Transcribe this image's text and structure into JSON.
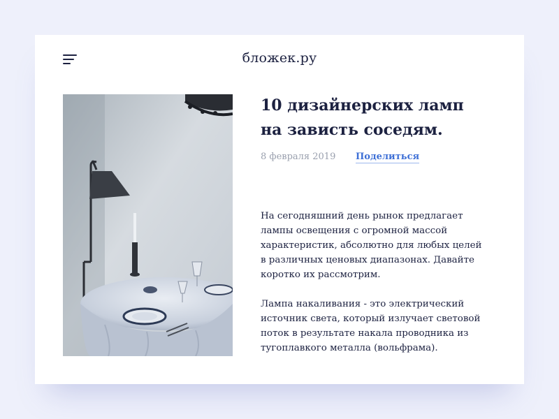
{
  "header": {
    "brand": "бложек.ру",
    "menu_icon": "hamburger-menu-icon"
  },
  "article": {
    "title_lines": [
      "10 дизайнерских ламп",
      "на зависть соседям."
    ],
    "date": "8 февраля 2019",
    "share_label": "Поделиться",
    "paragraphs": [
      {
        "lines": [
          "На сегодняшний день рынок предлагает",
          "лампы освещения с огромной массой",
          "характеристик, абсолютно для любых целей",
          "в различных ценовых диапазонах. Давайте",
          "коротко их рассмотрим."
        ]
      },
      {
        "lines": [
          "Лампа накаливания - это электрический",
          "источник света, который излучает световой",
          "поток в результате накала проводника из",
          "тугоплавкого металла (вольфрама)."
        ]
      }
    ]
  },
  "colors": {
    "background": "#eef0fb",
    "card": "#ffffff",
    "text": "#1c2140",
    "muted": "#9aa0ae",
    "accent": "#3d6fd6"
  }
}
